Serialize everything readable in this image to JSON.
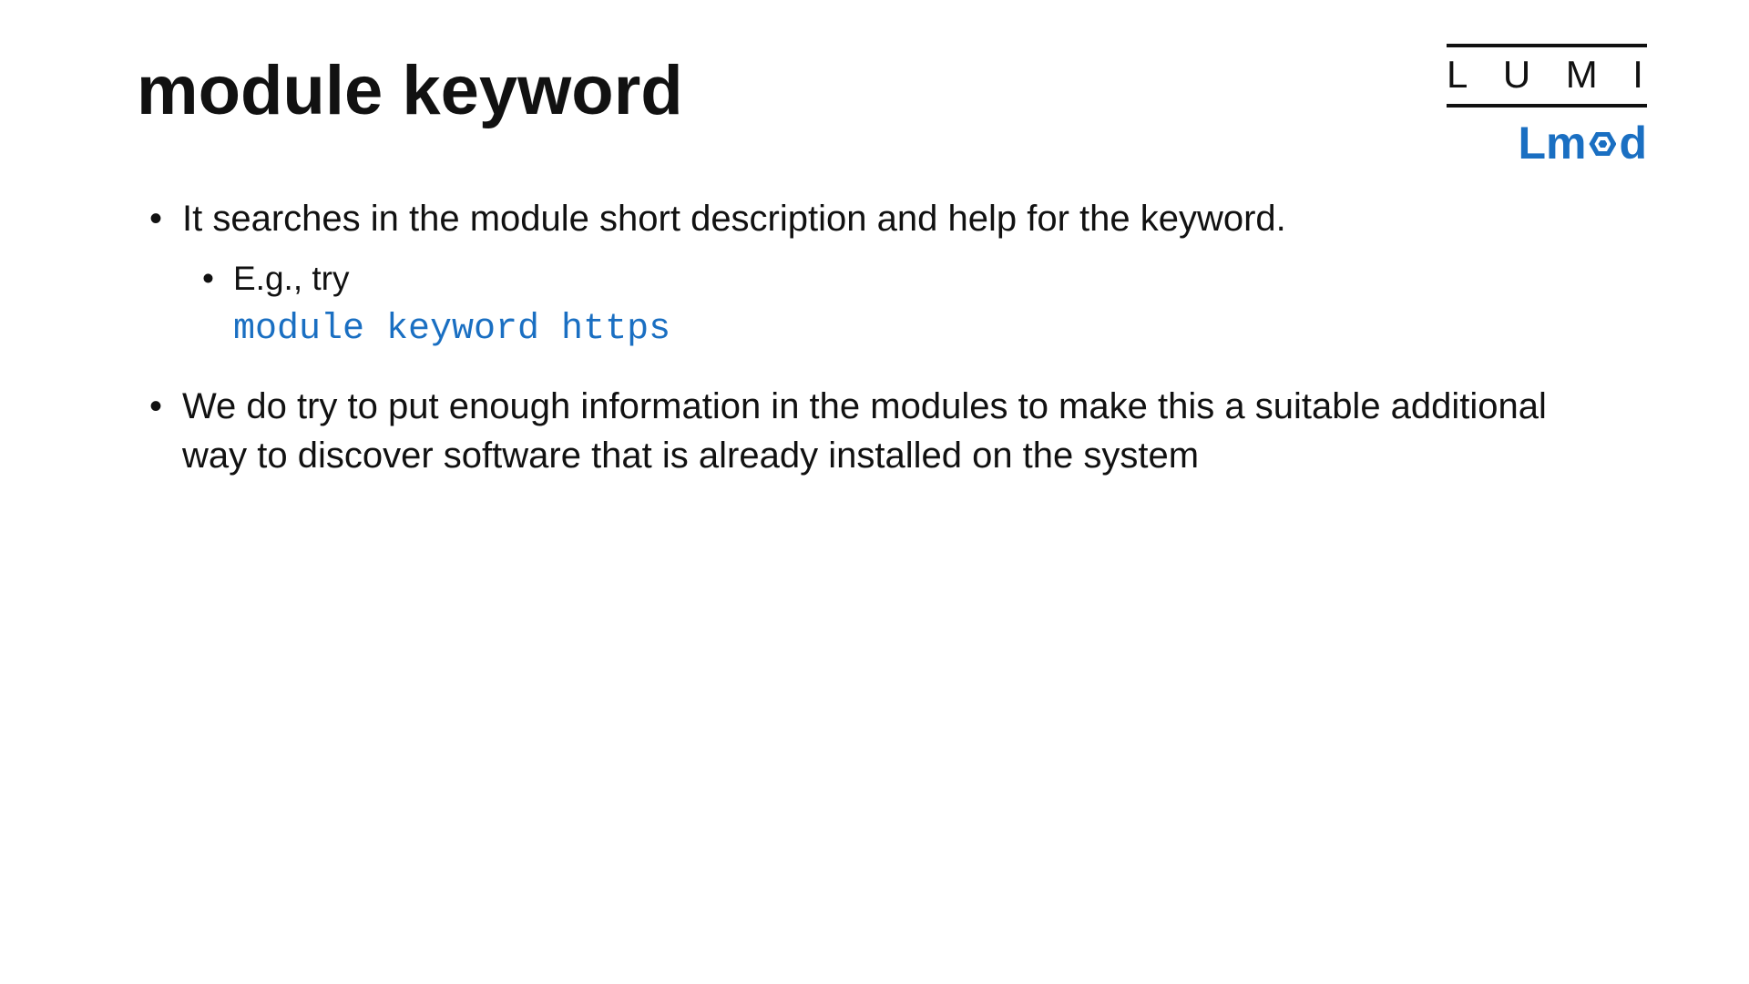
{
  "title": "module keyword",
  "logo": {
    "lumi_letters": [
      "L",
      "U",
      "M",
      "I"
    ],
    "lmod_prefix": "Lm",
    "lmod_suffix": "d"
  },
  "bullets": {
    "b1": "It searches in the module short description and help for the keyword.",
    "b1_sub_intro": "E.g., try",
    "b1_sub_code": "module keyword https",
    "b2": "We do try to put enough information in the modules to make this a suitable additional way to discover software that is already installed on the system"
  }
}
